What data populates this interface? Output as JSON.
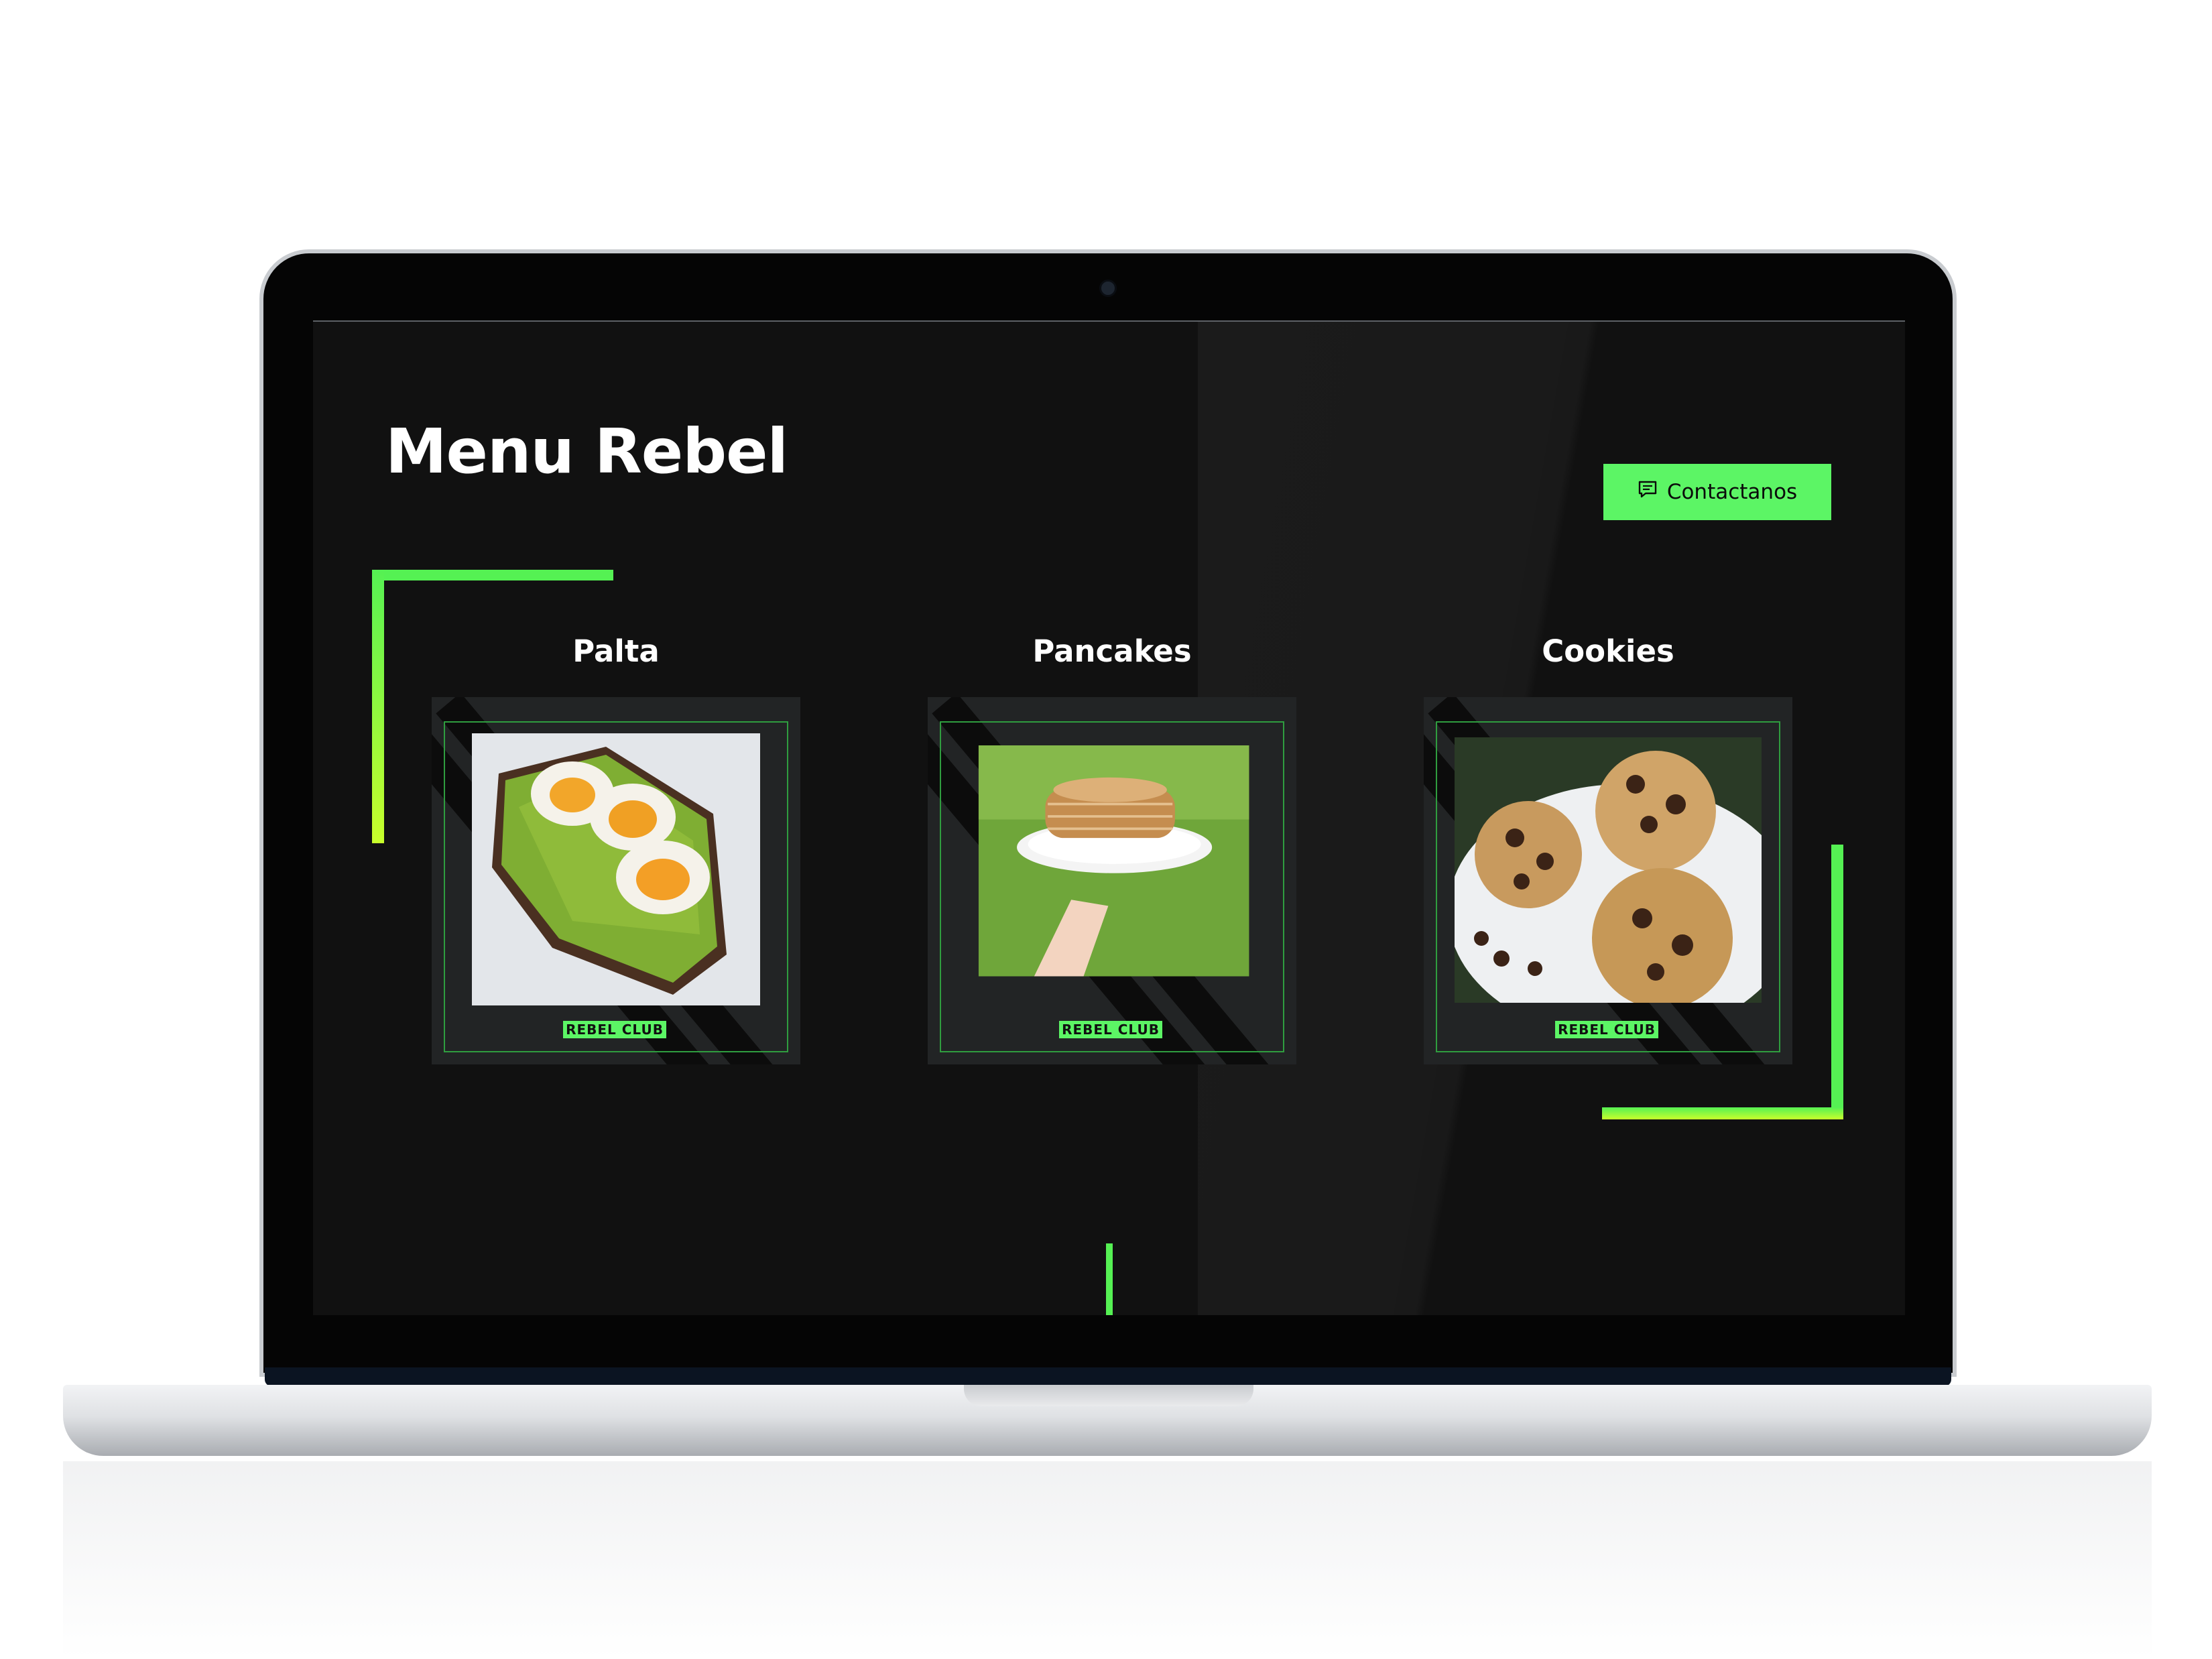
{
  "page": {
    "title": "Menu Rebel",
    "contact_label": "Contactanos",
    "accent": "#5cf565",
    "background": "#111111"
  },
  "menu": {
    "items": [
      {
        "name": "Palta",
        "brand": "REBEL CLUB"
      },
      {
        "name": "Pancakes",
        "brand": "REBEL CLUB"
      },
      {
        "name": "Cookies",
        "brand": "REBEL CLUB"
      }
    ]
  },
  "icons": {
    "contact": "chat-bubble-icon"
  }
}
